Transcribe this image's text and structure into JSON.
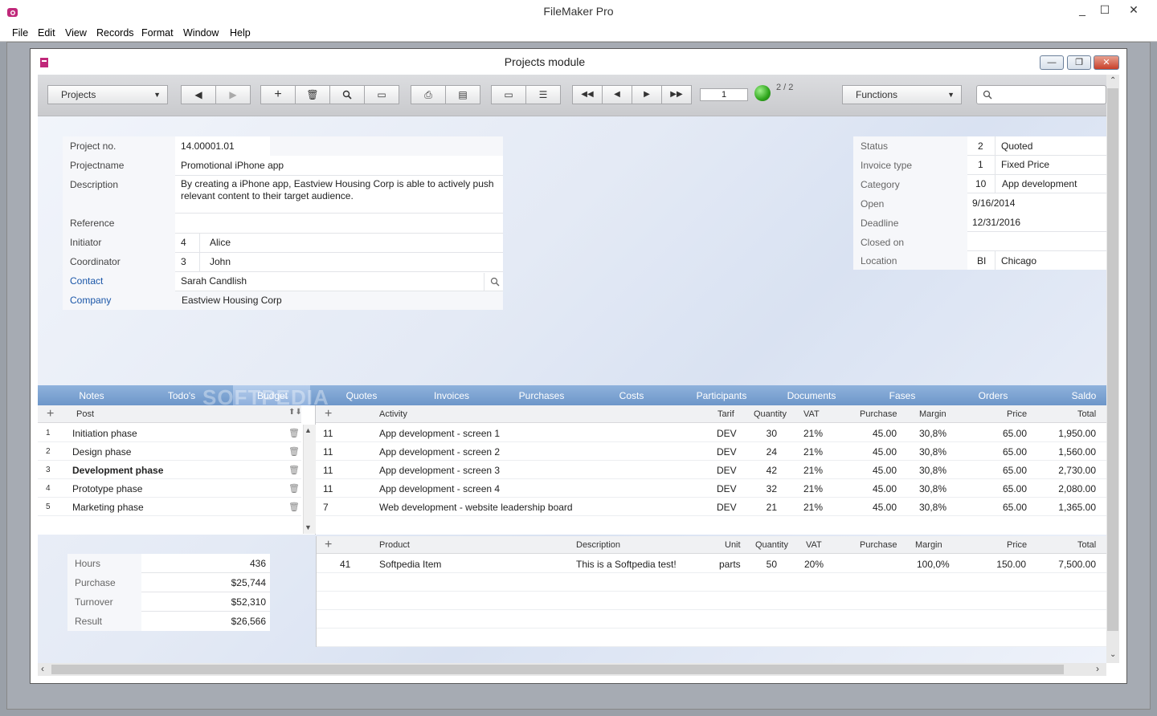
{
  "app": {
    "title": "FileMaker Pro",
    "min": "_",
    "max": "☐",
    "close": "✕"
  },
  "menu": [
    "File",
    "Edit",
    "View",
    "Records",
    "Format",
    "Window",
    "Help"
  ],
  "window": {
    "title": "Projects module"
  },
  "toolbar": {
    "layout_select": "Projects",
    "record_number": "1",
    "record_count": "2 / 2",
    "functions_select": "Functions",
    "search_placeholder": ""
  },
  "project": {
    "labels": {
      "project_no": "Project no.",
      "projectname": "Projectname",
      "description": "Description",
      "reference": "Reference",
      "initiator": "Initiator",
      "coordinator": "Coordinator",
      "contact": "Contact",
      "company": "Company"
    },
    "project_no": "14.00001.01",
    "projectname": "Promotional iPhone app",
    "description": "By creating a iPhone app, Eastview Housing Corp is able to actively push relevant content to their target audience.",
    "reference": "",
    "initiator_id": "4",
    "initiator_name": "Alice",
    "coordinator_id": "3",
    "coordinator_name": "John",
    "contact": "Sarah Candlish",
    "company": "Eastview Housing Corp"
  },
  "status_panel": {
    "labels": {
      "status": "Status",
      "invoice_type": "Invoice type",
      "category": "Category",
      "open": "Open",
      "deadline": "Deadline",
      "closed_on": "Closed on",
      "location": "Location"
    },
    "status_code": "2",
    "status": "Quoted",
    "invoice_code": "1",
    "invoice_type": "Fixed Price",
    "category_code": "10",
    "category": "App development",
    "open": "9/16/2014",
    "deadline": "12/31/2016",
    "closed_on": "",
    "location_code": "BI",
    "location": "Chicago"
  },
  "tabs": [
    "Notes",
    "Todo's",
    "Budget",
    "Quotes",
    "Invoices",
    "Purchases",
    "Costs",
    "Participants",
    "Documents",
    "Fases",
    "Orders",
    "Saldo"
  ],
  "watermark": "SOFTPEDIA",
  "posts": {
    "header": "Post",
    "add": "+",
    "items": [
      {
        "n": "1",
        "label": "Initiation phase"
      },
      {
        "n": "2",
        "label": "Design phase"
      },
      {
        "n": "3",
        "label": "Development phase"
      },
      {
        "n": "4",
        "label": "Prototype phase"
      },
      {
        "n": "5",
        "label": "Marketing phase"
      }
    ]
  },
  "activities": {
    "headers": {
      "add": "+",
      "activity": "Activity",
      "tarif": "Tarif",
      "quantity": "Quantity",
      "vat": "VAT",
      "purchase": "Purchase",
      "margin": "Margin",
      "price": "Price",
      "total": "Total"
    },
    "rows": [
      {
        "id": "11",
        "activity": "App development - screen 1",
        "tarif": "DEV",
        "qty": "30",
        "vat": "21%",
        "purchase": "45.00",
        "margin": "30,8%",
        "price": "65.00",
        "total": "1,950.00"
      },
      {
        "id": "11",
        "activity": "App development - screen 2",
        "tarif": "DEV",
        "qty": "24",
        "vat": "21%",
        "purchase": "45.00",
        "margin": "30,8%",
        "price": "65.00",
        "total": "1,560.00"
      },
      {
        "id": "11",
        "activity": "App development - screen 3",
        "tarif": "DEV",
        "qty": "42",
        "vat": "21%",
        "purchase": "45.00",
        "margin": "30,8%",
        "price": "65.00",
        "total": "2,730.00"
      },
      {
        "id": "11",
        "activity": "App development - screen 4",
        "tarif": "DEV",
        "qty": "32",
        "vat": "21%",
        "purchase": "45.00",
        "margin": "30,8%",
        "price": "65.00",
        "total": "2,080.00"
      },
      {
        "id": "7",
        "activity": "Web development - website leadership board",
        "tarif": "DEV",
        "qty": "21",
        "vat": "21%",
        "purchase": "45.00",
        "margin": "30,8%",
        "price": "65.00",
        "total": "1,365.00"
      }
    ]
  },
  "products": {
    "headers": {
      "add": "+",
      "product": "Product",
      "description": "Description",
      "unit": "Unit",
      "quantity": "Quantity",
      "vat": "VAT",
      "purchase": "Purchase",
      "margin": "Margin",
      "price": "Price",
      "total": "Total"
    },
    "rows": [
      {
        "id": "41",
        "product": "Softpedia Item",
        "description": "This is a Softpedia test!",
        "unit": "parts",
        "qty": "50",
        "vat": "20%",
        "purchase": "",
        "margin": "100,0%",
        "price": "150.00",
        "total": "7,500.00"
      }
    ]
  },
  "summary": {
    "hours_label": "Hours",
    "hours": "436",
    "purchase_label": "Purchase",
    "purchase": "$25,744",
    "turnover_label": "Turnover",
    "turnover": "$52,310",
    "result_label": "Result",
    "result": "$26,566"
  },
  "colors": {
    "accent": "#1a56a8",
    "tabbar": "#7aa0d0",
    "status_light": "#2ea51c"
  }
}
